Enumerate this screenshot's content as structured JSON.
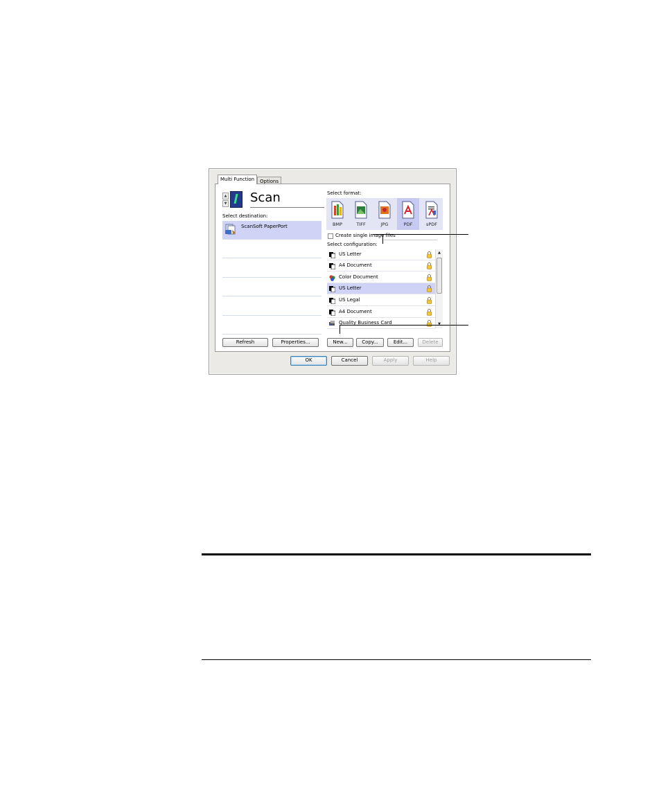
{
  "tabs": [
    {
      "label": "Multi Function",
      "active": true
    },
    {
      "label": "Options",
      "active": false
    }
  ],
  "header": {
    "title": "Scan",
    "spin_up": "▲",
    "spin_down": "▼"
  },
  "destination": {
    "label": "Select destination:",
    "items": [
      {
        "label": "ScanSoft PaperPort",
        "selected": true,
        "icon": "paperport-icon"
      }
    ]
  },
  "left_buttons": {
    "refresh": "Refresh",
    "properties": "Properties..."
  },
  "format": {
    "label": "Select format:",
    "items": [
      {
        "label": "BMP",
        "icon": "bmp-icon"
      },
      {
        "label": "TIFF",
        "icon": "tiff-icon"
      },
      {
        "label": "JPG",
        "icon": "jpg-icon"
      },
      {
        "label": "PDF",
        "icon": "pdf-icon",
        "selected": true
      },
      {
        "label": "sPDF",
        "icon": "spdf-icon"
      }
    ]
  },
  "single_image": {
    "label": "Create single image files",
    "checked": false
  },
  "configuration": {
    "label": "Select configuration:",
    "items": [
      {
        "label": "US Letter",
        "icon": "bw-document-icon",
        "locked": true
      },
      {
        "label": "A4 Document",
        "icon": "bw-document-icon",
        "locked": true
      },
      {
        "label": "Color Document",
        "icon": "color-document-icon",
        "locked": true
      },
      {
        "label": "US Letter",
        "icon": "bw-document-icon",
        "locked": true,
        "selected": true
      },
      {
        "label": "US Legal",
        "icon": "bw-document-icon",
        "locked": true
      },
      {
        "label": "A4 Document",
        "icon": "bw-document-icon",
        "locked": true
      },
      {
        "label": "Quality Business Card",
        "icon": "business-card-icon",
        "locked": true
      }
    ]
  },
  "config_buttons": {
    "new": "New...",
    "copy": "Copy...",
    "edit": "Edit...",
    "delete": "Delete"
  },
  "dialog_buttons": {
    "ok": "OK",
    "cancel": "Cancel",
    "apply": "Apply",
    "help": "Help"
  },
  "colors": {
    "selection": "#cfd3f5",
    "format_bg": "#e3e4f4",
    "dialog_bg": "#eceae6"
  }
}
